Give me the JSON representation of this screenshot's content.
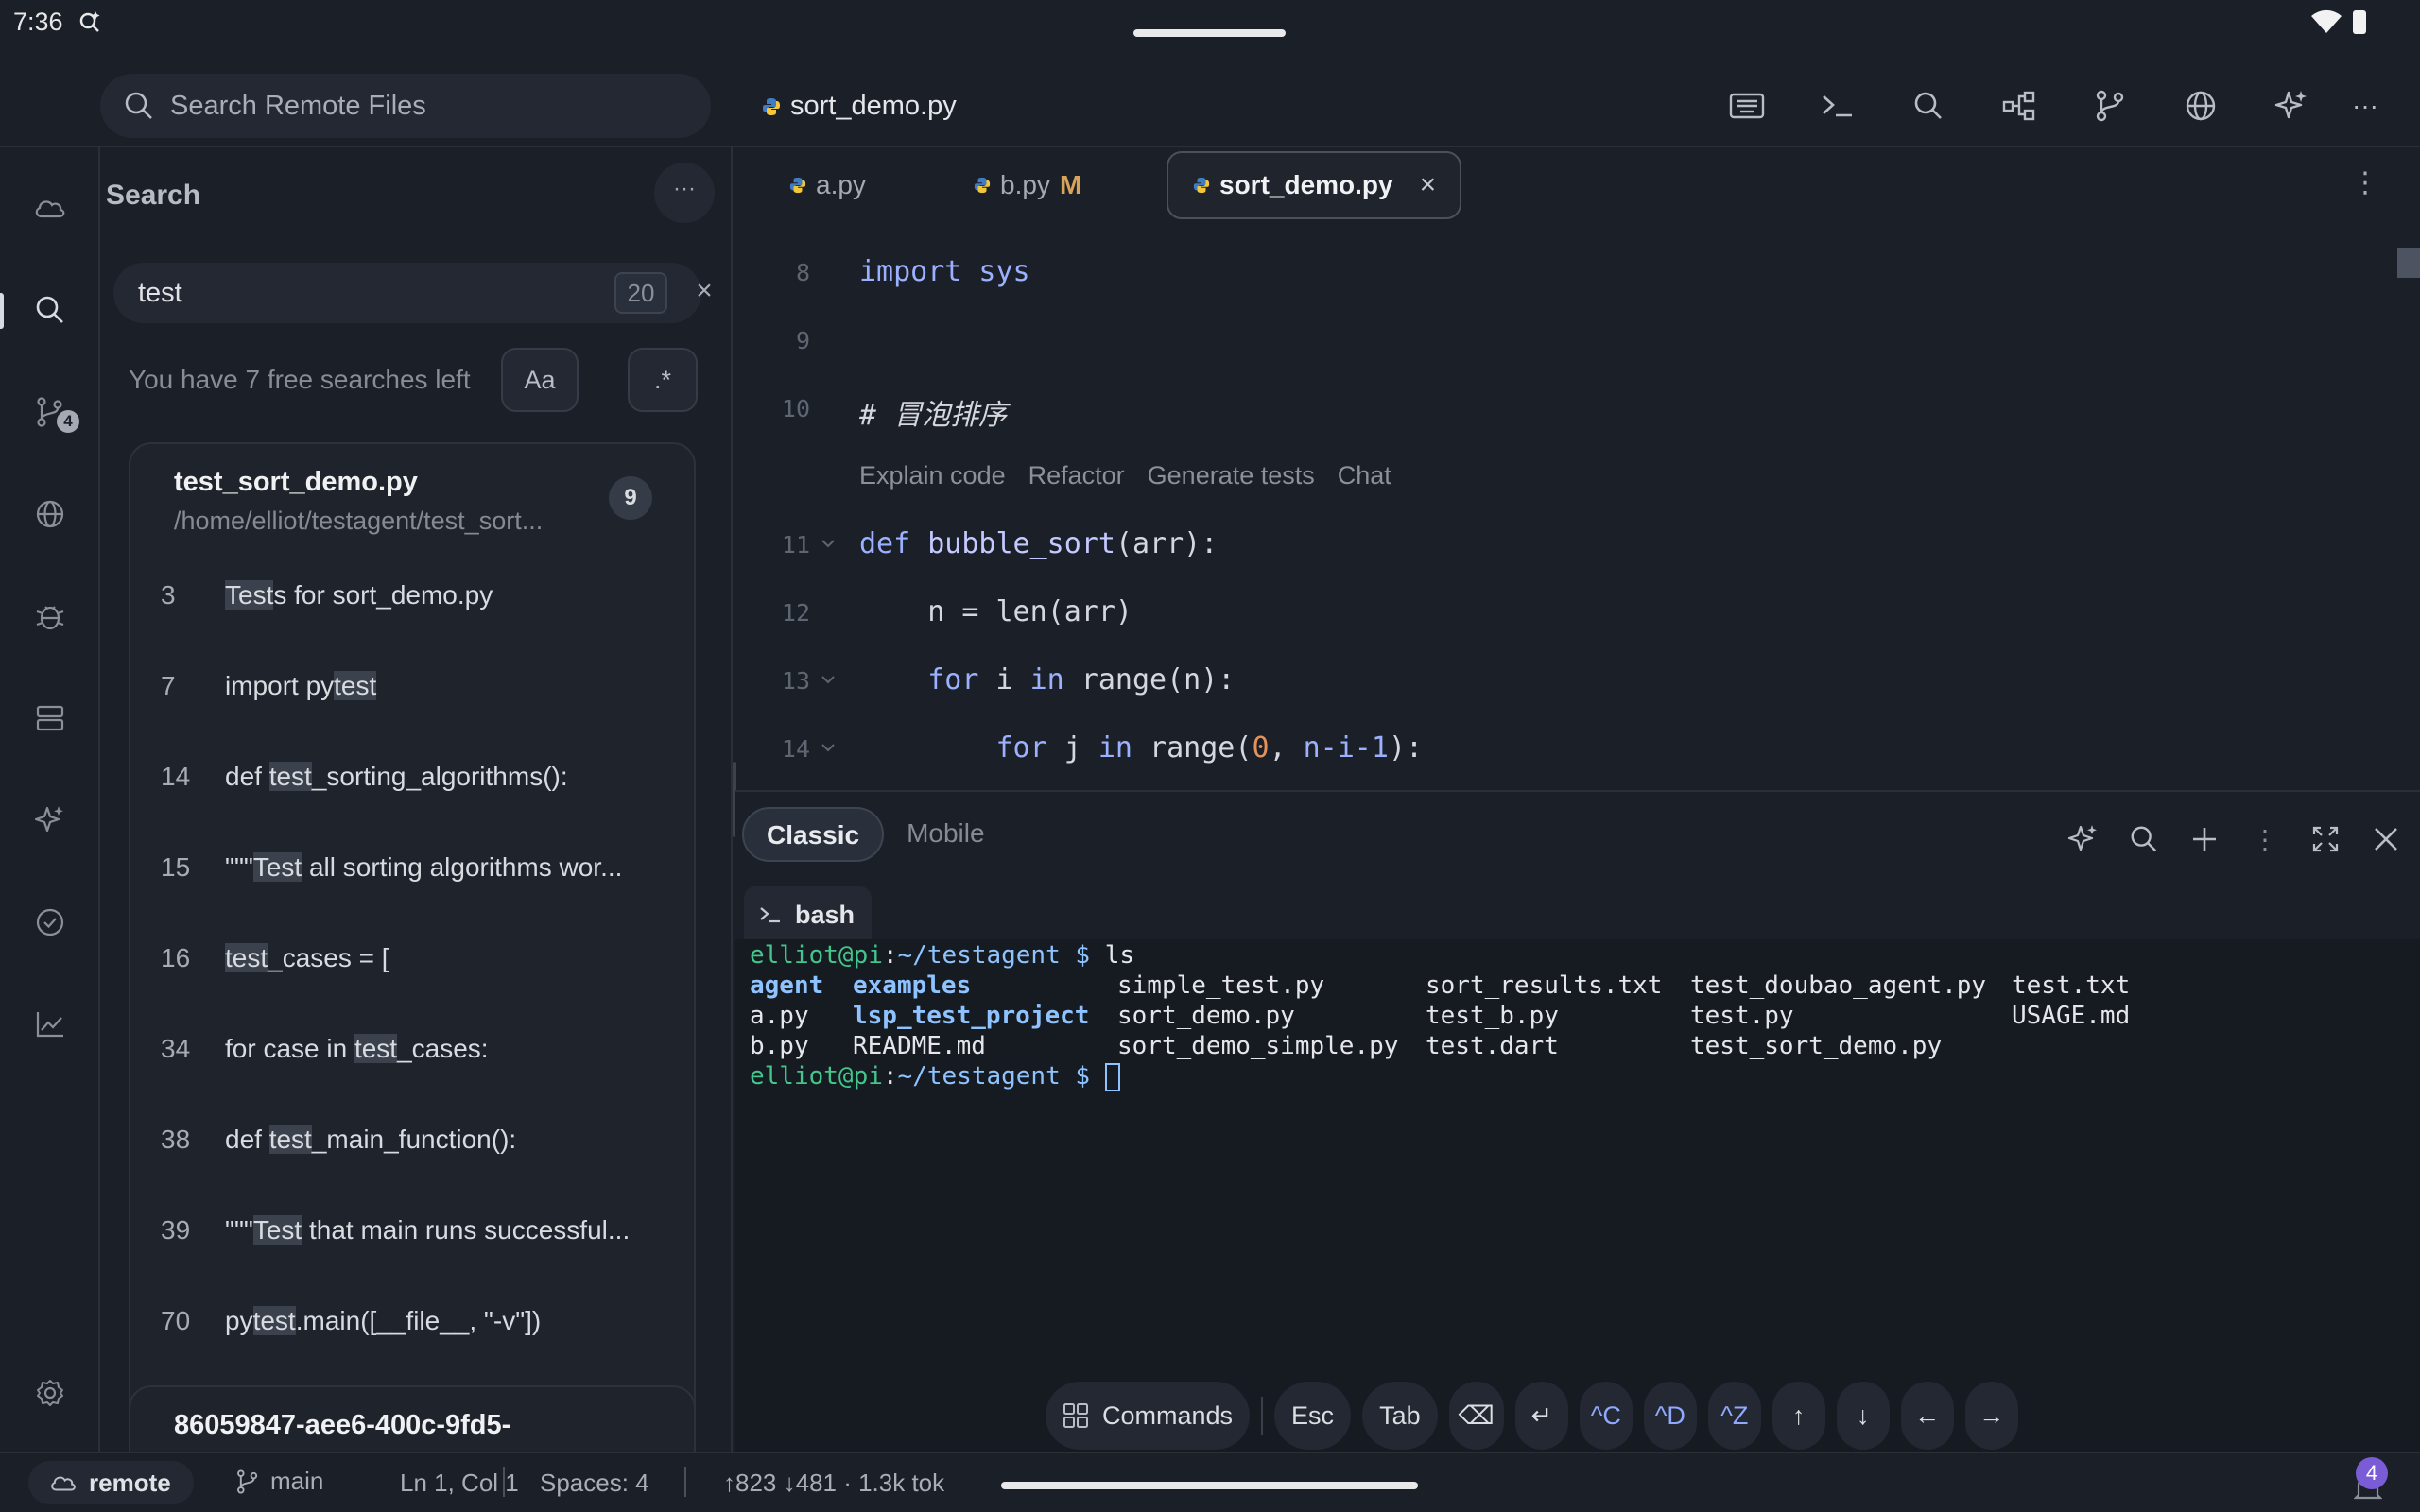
{
  "status_bar": {
    "time": "7:36"
  },
  "topbar": {
    "search_placeholder": "Search Remote Files",
    "active_file": "sort_demo.py"
  },
  "activity_bar": {
    "scm_badge": "4"
  },
  "search_panel": {
    "title": "Search",
    "more": "···",
    "query": "test",
    "result_count": "20",
    "clear": "×",
    "free_searches": "You have 7 free searches left",
    "match_case": "Aa",
    "regex": ".*",
    "results": [
      {
        "file": "test_sort_demo.py",
        "path": "/home/elliot/testagent/test_sort...",
        "count": "9",
        "lines": [
          {
            "num": "3",
            "before": "",
            "match": "Test",
            "after": "s for sort_demo.py"
          },
          {
            "num": "7",
            "before": "import py",
            "match": "test",
            "after": ""
          },
          {
            "num": "14",
            "before": "def ",
            "match": "test",
            "after": "_sorting_algorithms():"
          },
          {
            "num": "15",
            "before": "\"\"\"",
            "match": "Test",
            "after": " all sorting algorithms wor..."
          },
          {
            "num": "16",
            "before": "",
            "match": "test",
            "after": "_cases = ["
          },
          {
            "num": "34",
            "before": "for case in ",
            "match": "test",
            "after": "_cases:"
          },
          {
            "num": "38",
            "before": "def ",
            "match": "test",
            "after": "_main_function():"
          },
          {
            "num": "39",
            "before": "\"\"\"",
            "match": "Test",
            "after": " that main runs successful..."
          },
          {
            "num": "70",
            "before": "py",
            "match": "test",
            "after": ".main([__file__, \"-v\"])"
          }
        ]
      },
      {
        "file": "86059847-aee6-400c-9fd5-"
      }
    ]
  },
  "editor": {
    "tabs": [
      {
        "label": "a.py",
        "modified": ""
      },
      {
        "label": "b.py",
        "modified": "M"
      },
      {
        "label": "sort_demo.py",
        "modified": ""
      }
    ],
    "tab_close": "×",
    "tab_more": "⋮",
    "line_numbers": [
      "8",
      "9",
      "10",
      "11",
      "12",
      "13",
      "14"
    ],
    "code": {
      "l8_kw": "import",
      "l8_rest": " sys",
      "l10_comment": "# 冒泡排序",
      "l11_kw": "def",
      "l11_fn": " bubble_sort",
      "l11_rest": "(arr):",
      "l12_a": "    n = ",
      "l12_fn": "len",
      "l12_b": "(arr)",
      "l13_kw": "    for",
      "l13_a": " i ",
      "l13_kw2": "in",
      "l13_b": " range(n):",
      "l14_kw": "        for",
      "l14_a": " j ",
      "l14_kw2": "in",
      "l14_b": " range(",
      "l14_num": "0",
      "l14_c": ", ",
      "l14_var": "n-i-1",
      "l14_d": "):"
    },
    "codelens": [
      "Explain code",
      "Refactor",
      "Generate tests",
      "Chat"
    ]
  },
  "terminal": {
    "modes": [
      "Classic",
      "Mobile"
    ],
    "tab_label": "bash",
    "prompt_user": "elliot@pi",
    "prompt_path": "~/testagent",
    "prompt_sign": "$",
    "command": "ls",
    "listing": [
      [
        "agent",
        "examples",
        "simple_test.py",
        "sort_results.txt",
        "test_doubao_agent.py",
        "test.txt"
      ],
      [
        "a.py",
        "lsp_test_project",
        "sort_demo.py",
        "test_b.py",
        "test.py",
        "USAGE.md"
      ],
      [
        "b.py",
        "README.md",
        "sort_demo_simple.py",
        "test.dart",
        "test_sort_demo.py",
        ""
      ]
    ]
  },
  "keybar": {
    "commands": "Commands",
    "esc": "Esc",
    "tab": "Tab",
    "backspace": "⌫",
    "enter": "↵",
    "ctrl_c": "^C",
    "ctrl_d": "^D",
    "ctrl_z": "^Z",
    "up": "↑",
    "down": "↓",
    "left": "←",
    "right": "→"
  },
  "bottom_bar": {
    "remote": "remote",
    "branch": "main",
    "position": "Ln 1, Col 1",
    "spaces": "Spaces: 4",
    "tokens": "↑823 ↓481 · 1.3k tok",
    "notifications": "4"
  }
}
